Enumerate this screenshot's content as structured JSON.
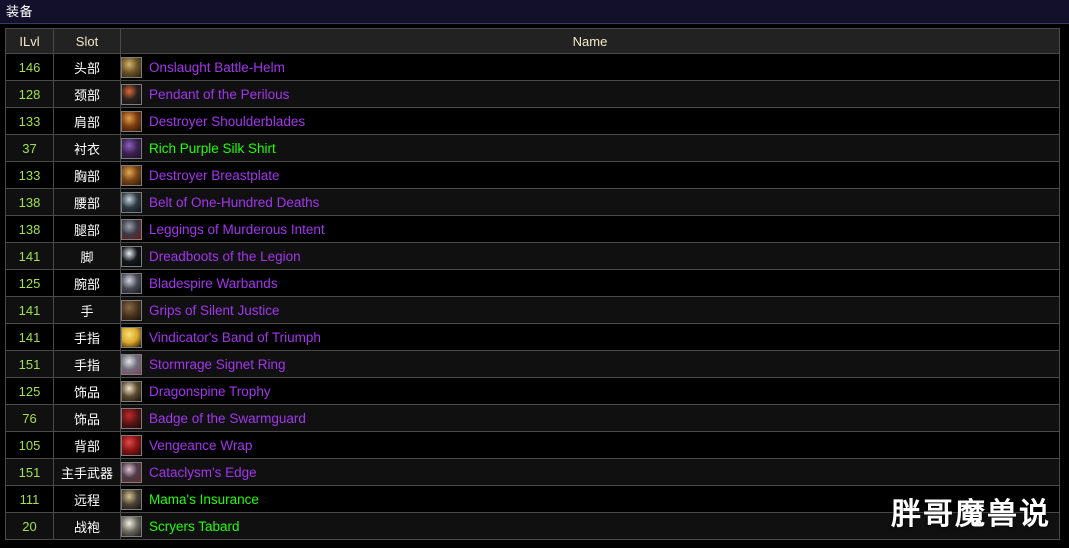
{
  "window": {
    "title": "装备"
  },
  "table": {
    "columns": [
      "ILvl",
      "Slot",
      "Name"
    ],
    "rows": [
      {
        "ilvl": "146",
        "slot": "头部",
        "name": "Onslaught Battle-Helm",
        "quality": "epic",
        "icon": "helm-icon",
        "c1": "#6a5326",
        "c2": "#d6b36a",
        "c3": "#2a1f0d"
      },
      {
        "ilvl": "128",
        "slot": "颈部",
        "name": "Pendant of the Perilous",
        "quality": "epic",
        "icon": "pendant-icon",
        "c1": "#2a2220",
        "c2": "#e06a35",
        "c3": "#14100e"
      },
      {
        "ilvl": "133",
        "slot": "肩部",
        "name": "Destroyer Shoulderblades",
        "quality": "epic",
        "icon": "shoulder-icon",
        "c1": "#7a3b10",
        "c2": "#e2a14a",
        "c3": "#2b1405"
      },
      {
        "ilvl": "37",
        "slot": "衬衣",
        "name": "Rich Purple Silk Shirt",
        "quality": "uncommon",
        "icon": "shirt-icon",
        "c1": "#3c2250",
        "c2": "#8b5fc0",
        "c3": "#1b0f26"
      },
      {
        "ilvl": "133",
        "slot": "胸部",
        "name": "Destroyer Breastplate",
        "quality": "epic",
        "icon": "chest-icon",
        "c1": "#7a4414",
        "c2": "#e0a855",
        "c3": "#2b1705"
      },
      {
        "ilvl": "138",
        "slot": "腰部",
        "name": "Belt of One-Hundred Deaths",
        "quality": "epic",
        "icon": "belt-icon",
        "c1": "#2e3a44",
        "c2": "#c8d4dc",
        "c3": "#0d1216"
      },
      {
        "ilvl": "138",
        "slot": "腿部",
        "name": "Leggings of Murderous Intent",
        "quality": "epic",
        "icon": "legs-icon",
        "c1": "#3a3a44",
        "c2": "#9aa0ad",
        "c3": "#7a1414"
      },
      {
        "ilvl": "141",
        "slot": "脚",
        "name": "Dreadboots of the Legion",
        "quality": "epic",
        "icon": "boots-icon",
        "c1": "#14181c",
        "c2": "#e8eef2",
        "c3": "#05080a"
      },
      {
        "ilvl": "125",
        "slot": "腕部",
        "name": "Bladespire Warbands",
        "quality": "epic",
        "icon": "bracer-icon",
        "c1": "#4a4a56",
        "c2": "#d2d6e0",
        "c3": "#16161c"
      },
      {
        "ilvl": "141",
        "slot": "手",
        "name": "Grips of Silent Justice",
        "quality": "epic",
        "icon": "gloves-icon",
        "c1": "#4a3420",
        "c2": "#8a6a44",
        "c3": "#14100a"
      },
      {
        "ilvl": "141",
        "slot": "手指",
        "name": "Vindicator's Band of Triumph",
        "quality": "epic",
        "icon": "ring-icon",
        "c1": "#d9a72a",
        "c2": "#f5e07a",
        "c3": "#1a1006"
      },
      {
        "ilvl": "151",
        "slot": "手指",
        "name": "Stormrage Signet Ring",
        "quality": "epic",
        "icon": "ring2-icon",
        "c1": "#6e6e7a",
        "c2": "#e2e2ea",
        "c3": "#8a3a5a"
      },
      {
        "ilvl": "125",
        "slot": "饰品",
        "name": "Dragonspine Trophy",
        "quality": "epic",
        "icon": "trophy-icon",
        "c1": "#5a4a30",
        "c2": "#efe6cc",
        "c3": "#16120a"
      },
      {
        "ilvl": "76",
        "slot": "饰品",
        "name": "Badge of the Swarmguard",
        "quality": "epic",
        "icon": "badge-icon",
        "c1": "#5a1414",
        "c2": "#c02a2a",
        "c3": "#1c0606"
      },
      {
        "ilvl": "105",
        "slot": "背部",
        "name": "Vengeance Wrap",
        "quality": "epic",
        "icon": "cloak-icon",
        "c1": "#8a1414",
        "c2": "#e04a4a",
        "c3": "#2a0606"
      },
      {
        "ilvl": "151",
        "slot": "主手武器",
        "name": "Cataclysm's Edge",
        "quality": "epic",
        "icon": "sword-icon",
        "c1": "#4a3a46",
        "c2": "#e0c0d0",
        "c3": "#6a2a2a"
      },
      {
        "ilvl": "111",
        "slot": "远程",
        "name": "Mama's Insurance",
        "quality": "uncommon",
        "icon": "gun-icon",
        "c1": "#4a4238",
        "c2": "#d6c48a",
        "c3": "#16120c"
      },
      {
        "ilvl": "20",
        "slot": "战袍",
        "name": "Scryers Tabard",
        "quality": "uncommon",
        "icon": "tabard-icon",
        "c1": "#6a6a60",
        "c2": "#f2f0e4",
        "c3": "#1a1a16"
      }
    ]
  },
  "watermark": {
    "text": "胖哥魔兽说"
  },
  "colors": {
    "epic": "#a335ee",
    "uncommon": "#1eff00",
    "ilvl": "#9fe24a",
    "header_text": "#f2e9c8",
    "titlebar_bg": "#12102b"
  }
}
